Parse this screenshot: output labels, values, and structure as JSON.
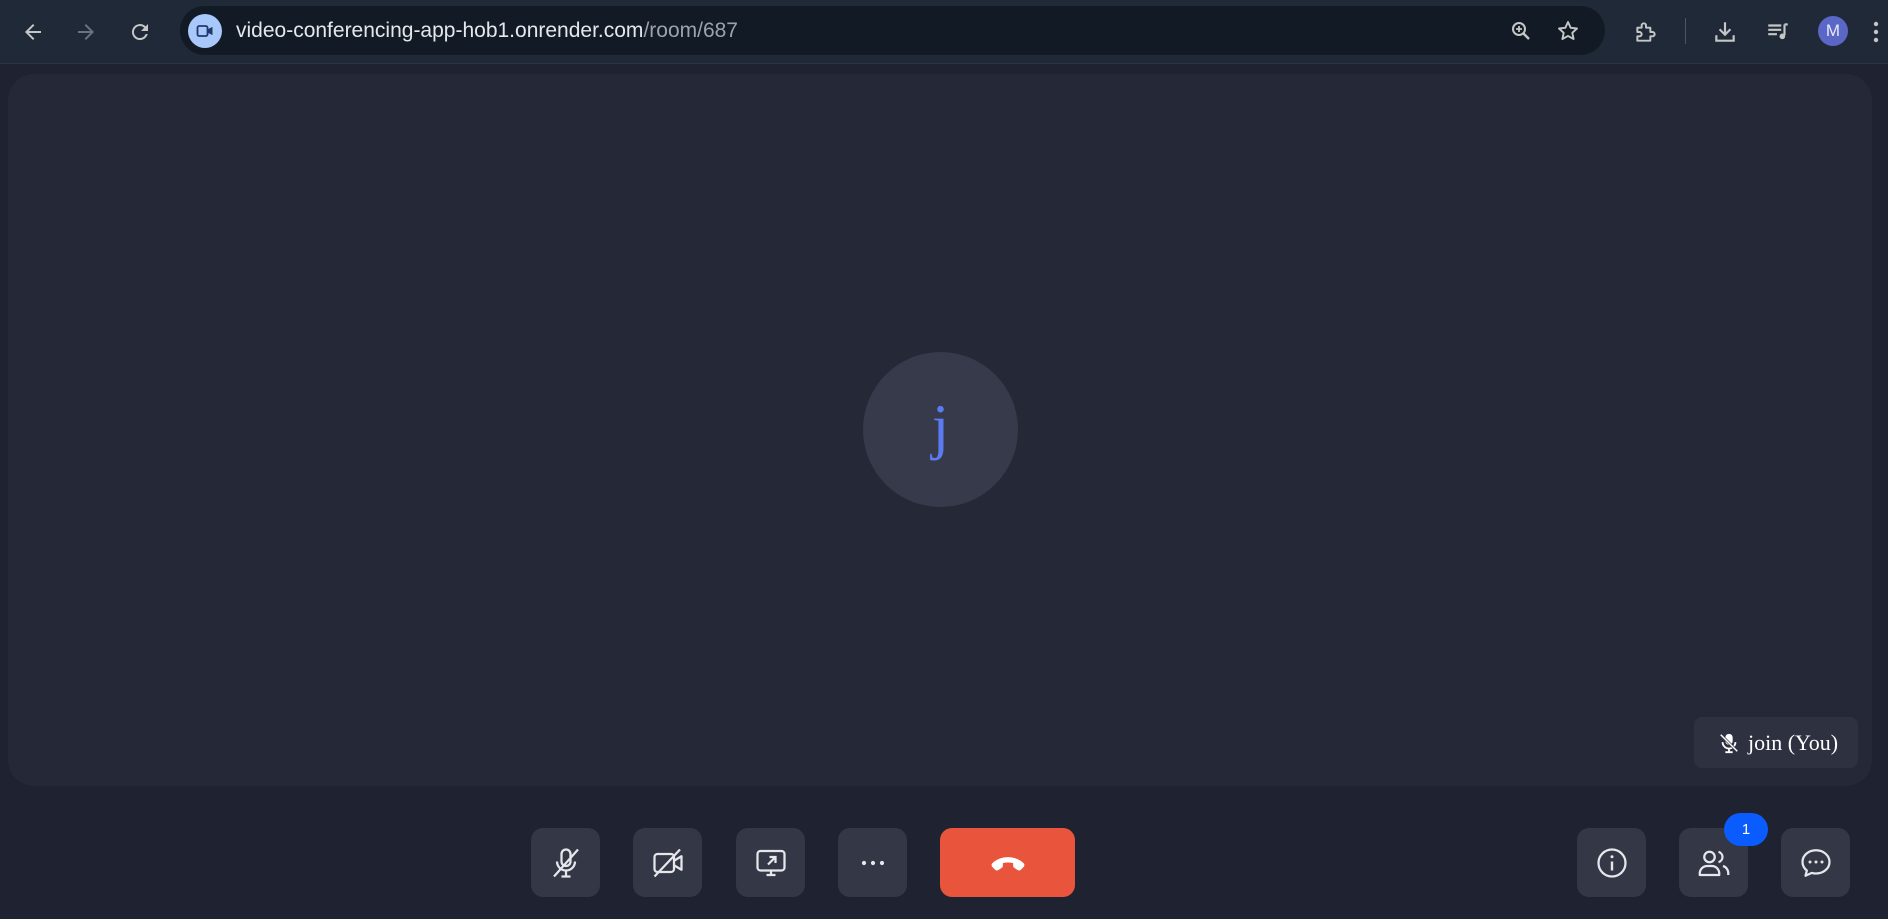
{
  "browser": {
    "url_host": "video-conferencing-app-hob1.onrender.com",
    "url_path": "/room/687",
    "profile_initial": "M"
  },
  "icons": {
    "back": "arrow-left-icon",
    "forward": "arrow-right-icon",
    "reload": "reload-icon",
    "site": "video-camera-icon",
    "zoom": "zoom-icon",
    "bookmark": "star-icon",
    "extensions": "puzzle-icon",
    "downloads": "download-icon",
    "media": "media-queue-icon",
    "menu": "kebab-menu-icon"
  },
  "participant": {
    "avatar_letter": "j",
    "name_label": "join (You)",
    "muted": true
  },
  "controls": {
    "mic": "mic-off-icon",
    "camera": "camera-off-icon",
    "share": "screen-share-icon",
    "more": "more-icon",
    "end_call": "phone-hangup-icon",
    "info": "info-icon",
    "people": "people-icon",
    "chat": "chat-icon",
    "people_count": "1"
  },
  "colors": {
    "background": "#1f2230",
    "tile": "#252836",
    "control": "#343746",
    "hangup": "#e8553c",
    "badge": "#0b5cff",
    "avatar_letter": "#5b7bf0"
  }
}
